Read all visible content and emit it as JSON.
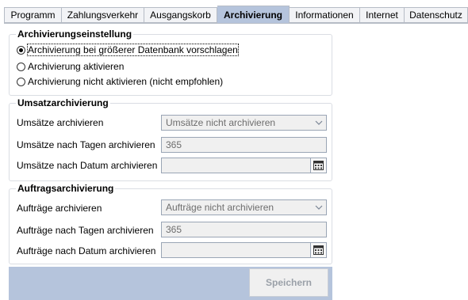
{
  "tabs": [
    {
      "label": "Programm",
      "active": false
    },
    {
      "label": "Zahlungsverkehr",
      "active": false
    },
    {
      "label": "Ausgangskorb",
      "active": false
    },
    {
      "label": "Archivierung",
      "active": true
    },
    {
      "label": "Informationen",
      "active": false
    },
    {
      "label": "Internet",
      "active": false
    },
    {
      "label": "Datenschutz",
      "active": false
    }
  ],
  "archiving_settings": {
    "title": "Archivierungseinstellung",
    "options": [
      {
        "label": "Archivierung bei größerer Datenbank vorschlagen",
        "checked": true
      },
      {
        "label": "Archivierung aktivieren",
        "checked": false
      },
      {
        "label": "Archivierung nicht aktivieren (nicht empfohlen)",
        "checked": false
      }
    ]
  },
  "sales_archiving": {
    "title": "Umsatzarchivierung",
    "archive_label": "Umsätze archivieren",
    "archive_value": "Umsätze nicht archivieren",
    "days_label": "Umsätze nach Tagen archivieren",
    "days_value": "365",
    "date_label": "Umsätze nach Datum archivieren",
    "date_value": ""
  },
  "order_archiving": {
    "title": "Auftragsarchivierung",
    "archive_label": "Aufträge archivieren",
    "archive_value": "Aufträge nicht archivieren",
    "days_label": "Aufträge nach Tagen archivieren",
    "days_value": "365",
    "date_label": "Aufträge nach Datum archivieren",
    "date_value": ""
  },
  "footer": {
    "save_label": "Speichern"
  },
  "colors": {
    "active_tab": "#b5c4dc",
    "footer_bg": "#b5c4dc",
    "disabled_field": "#f0f0f0"
  },
  "icons": {
    "dropdown": "chevron-down-icon",
    "calendar": "calendar-icon"
  }
}
